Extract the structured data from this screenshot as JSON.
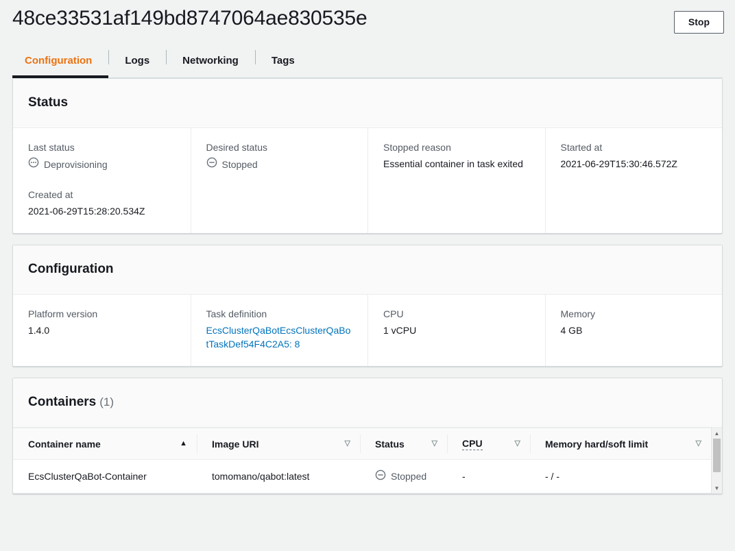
{
  "header": {
    "title": "48ce33531af149bd8747064ae830535e",
    "stop_label": "Stop"
  },
  "tabs": [
    {
      "label": "Configuration",
      "active": true
    },
    {
      "label": "Logs",
      "active": false
    },
    {
      "label": "Networking",
      "active": false
    },
    {
      "label": "Tags",
      "active": false
    }
  ],
  "status_card": {
    "title": "Status",
    "fields": {
      "last_status_label": "Last status",
      "last_status_value": "Deprovisioning",
      "last_status_icon": "pending-circle-icon",
      "created_at_label": "Created at",
      "created_at_value": "2021-06-29T15:28:20.534Z",
      "desired_status_label": "Desired status",
      "desired_status_value": "Stopped",
      "desired_status_icon": "stopped-circle-icon",
      "stopped_reason_label": "Stopped reason",
      "stopped_reason_value": "Essential container in task exited",
      "started_at_label": "Started at",
      "started_at_value": "2021-06-29T15:30:46.572Z"
    }
  },
  "configuration_card": {
    "title": "Configuration",
    "fields": {
      "platform_version_label": "Platform version",
      "platform_version_value": "1.4.0",
      "task_definition_label": "Task definition",
      "task_definition_value": "EcsClusterQaBotEcsClusterQaBotTaskDef54F4C2A5: 8",
      "cpu_label": "CPU",
      "cpu_value": "1 vCPU",
      "memory_label": "Memory",
      "memory_value": "4 GB"
    }
  },
  "containers_card": {
    "title": "Containers",
    "count": "(1)",
    "columns": [
      {
        "label": "Container name",
        "sort": "asc",
        "tooltip": false
      },
      {
        "label": "Image URI",
        "sort": "none",
        "tooltip": false
      },
      {
        "label": "Status",
        "sort": "none",
        "tooltip": false
      },
      {
        "label": "CPU",
        "sort": "none",
        "tooltip": true
      },
      {
        "label": "Memory hard/soft limit",
        "sort": "none",
        "tooltip": false
      }
    ],
    "rows": [
      {
        "container_name": "EcsClusterQaBot-Container",
        "image_uri": "tomomano/qabot:latest",
        "status": "Stopped",
        "status_icon": "stopped-circle-icon",
        "cpu": "-",
        "memory": "- / -"
      }
    ]
  },
  "colors": {
    "accent_orange": "#ec7211",
    "link_blue": "#0073bb",
    "muted_text": "#545b64",
    "page_background": "#f1f3f3"
  },
  "icons": {
    "sort_asc": "▲",
    "sort_none": "▽",
    "scroll_up": "▲",
    "scroll_down": "▼"
  }
}
